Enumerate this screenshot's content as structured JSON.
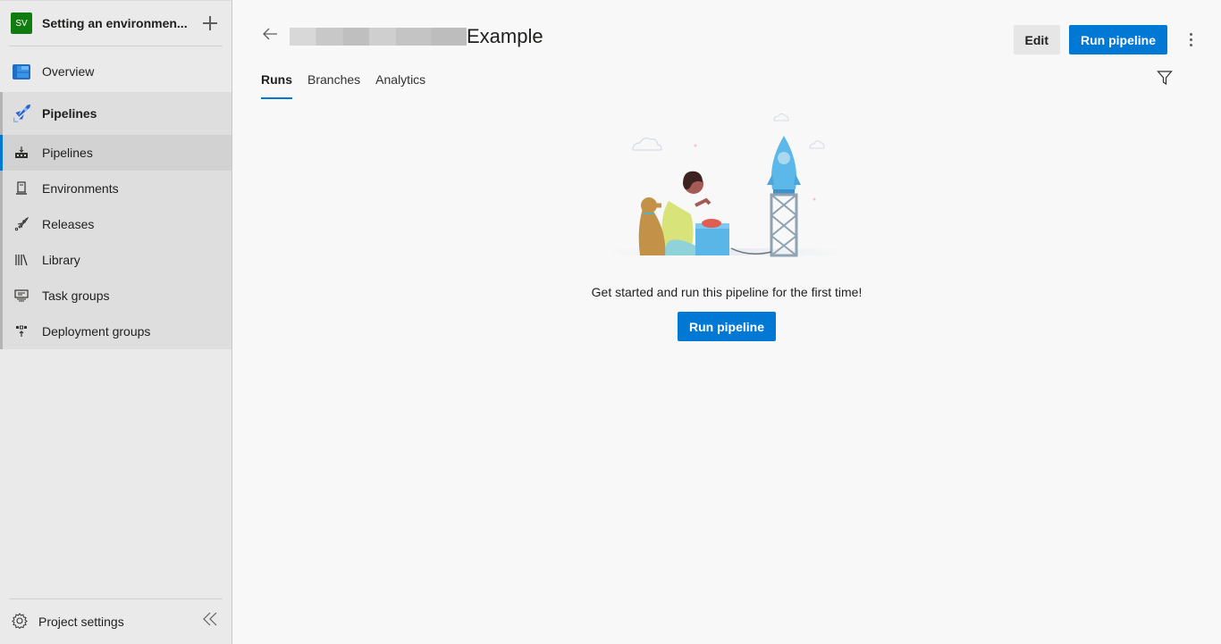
{
  "project": {
    "initials": "SV",
    "name": "Setting an environmen...",
    "avatar_color": "#107c10"
  },
  "sidebar": {
    "overview": "Overview",
    "group": {
      "label": "Pipelines",
      "items": [
        {
          "label": "Pipelines",
          "icon": "pipelines-icon",
          "active": true
        },
        {
          "label": "Environments",
          "icon": "environments-icon"
        },
        {
          "label": "Releases",
          "icon": "releases-icon"
        },
        {
          "label": "Library",
          "icon": "library-icon"
        },
        {
          "label": "Task groups",
          "icon": "task-groups-icon"
        },
        {
          "label": "Deployment groups",
          "icon": "deployment-groups-icon"
        }
      ]
    },
    "settings": "Project settings"
  },
  "header": {
    "title_suffix": "Example",
    "edit_label": "Edit",
    "run_label": "Run pipeline"
  },
  "tabs": [
    {
      "label": "Runs",
      "active": true
    },
    {
      "label": "Branches"
    },
    {
      "label": "Analytics"
    }
  ],
  "empty_state": {
    "message": "Get started and run this pipeline for the first time!",
    "button_label": "Run pipeline"
  },
  "colors": {
    "accent": "#0078d4"
  }
}
